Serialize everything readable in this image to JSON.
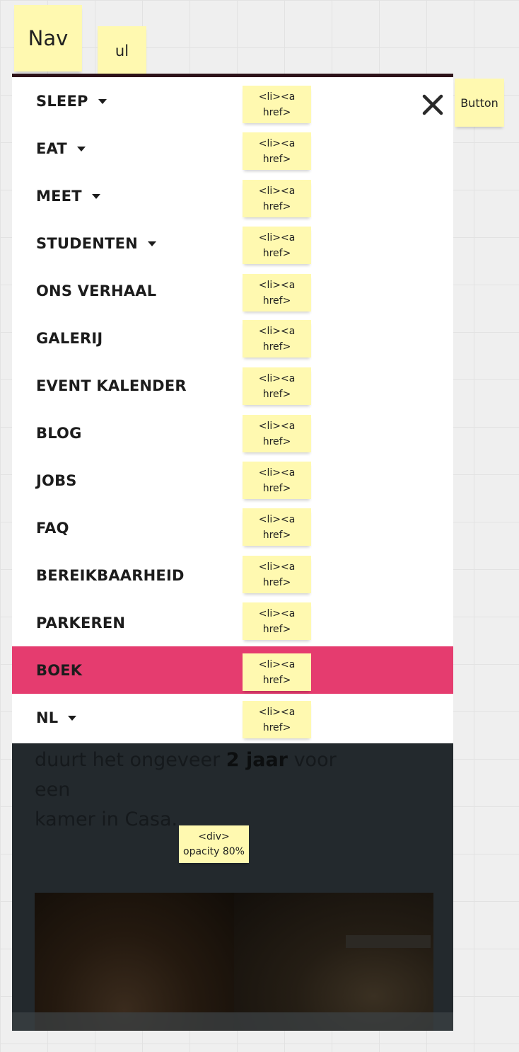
{
  "annotations": {
    "nav_label": "Nav",
    "ul_label": "ul",
    "button_label": "Button",
    "li_label_line1": "<li><a",
    "li_label_line2": "href>",
    "div_label_line1": "<div>",
    "div_label_line2": "opacity 80%"
  },
  "menu": {
    "items": [
      {
        "label": "SLEEP",
        "dropdown": true
      },
      {
        "label": "EAT",
        "dropdown": true
      },
      {
        "label": "MEET",
        "dropdown": true
      },
      {
        "label": "STUDENTEN",
        "dropdown": true
      },
      {
        "label": "ONS VERHAAL",
        "dropdown": false
      },
      {
        "label": "GALERIJ",
        "dropdown": false
      },
      {
        "label": "EVENT KALENDER",
        "dropdown": false
      },
      {
        "label": "BLOG",
        "dropdown": false
      },
      {
        "label": "JOBS",
        "dropdown": false
      },
      {
        "label": "FAQ",
        "dropdown": false
      },
      {
        "label": "BEREIKBAARHEID",
        "dropdown": false
      },
      {
        "label": "PARKEREN",
        "dropdown": false
      },
      {
        "label": "BOEK",
        "dropdown": false,
        "highlight": true
      },
      {
        "label": "NL",
        "dropdown": true
      }
    ],
    "close_icon": "close-icon",
    "highlight_color": "#e53c6f"
  },
  "page": {
    "text_line1_pre": "duurt het ongeveer ",
    "text_line1_bold": "2 jaar",
    "text_line1_post": " voor een",
    "text_line2": "kamer in Casa."
  }
}
